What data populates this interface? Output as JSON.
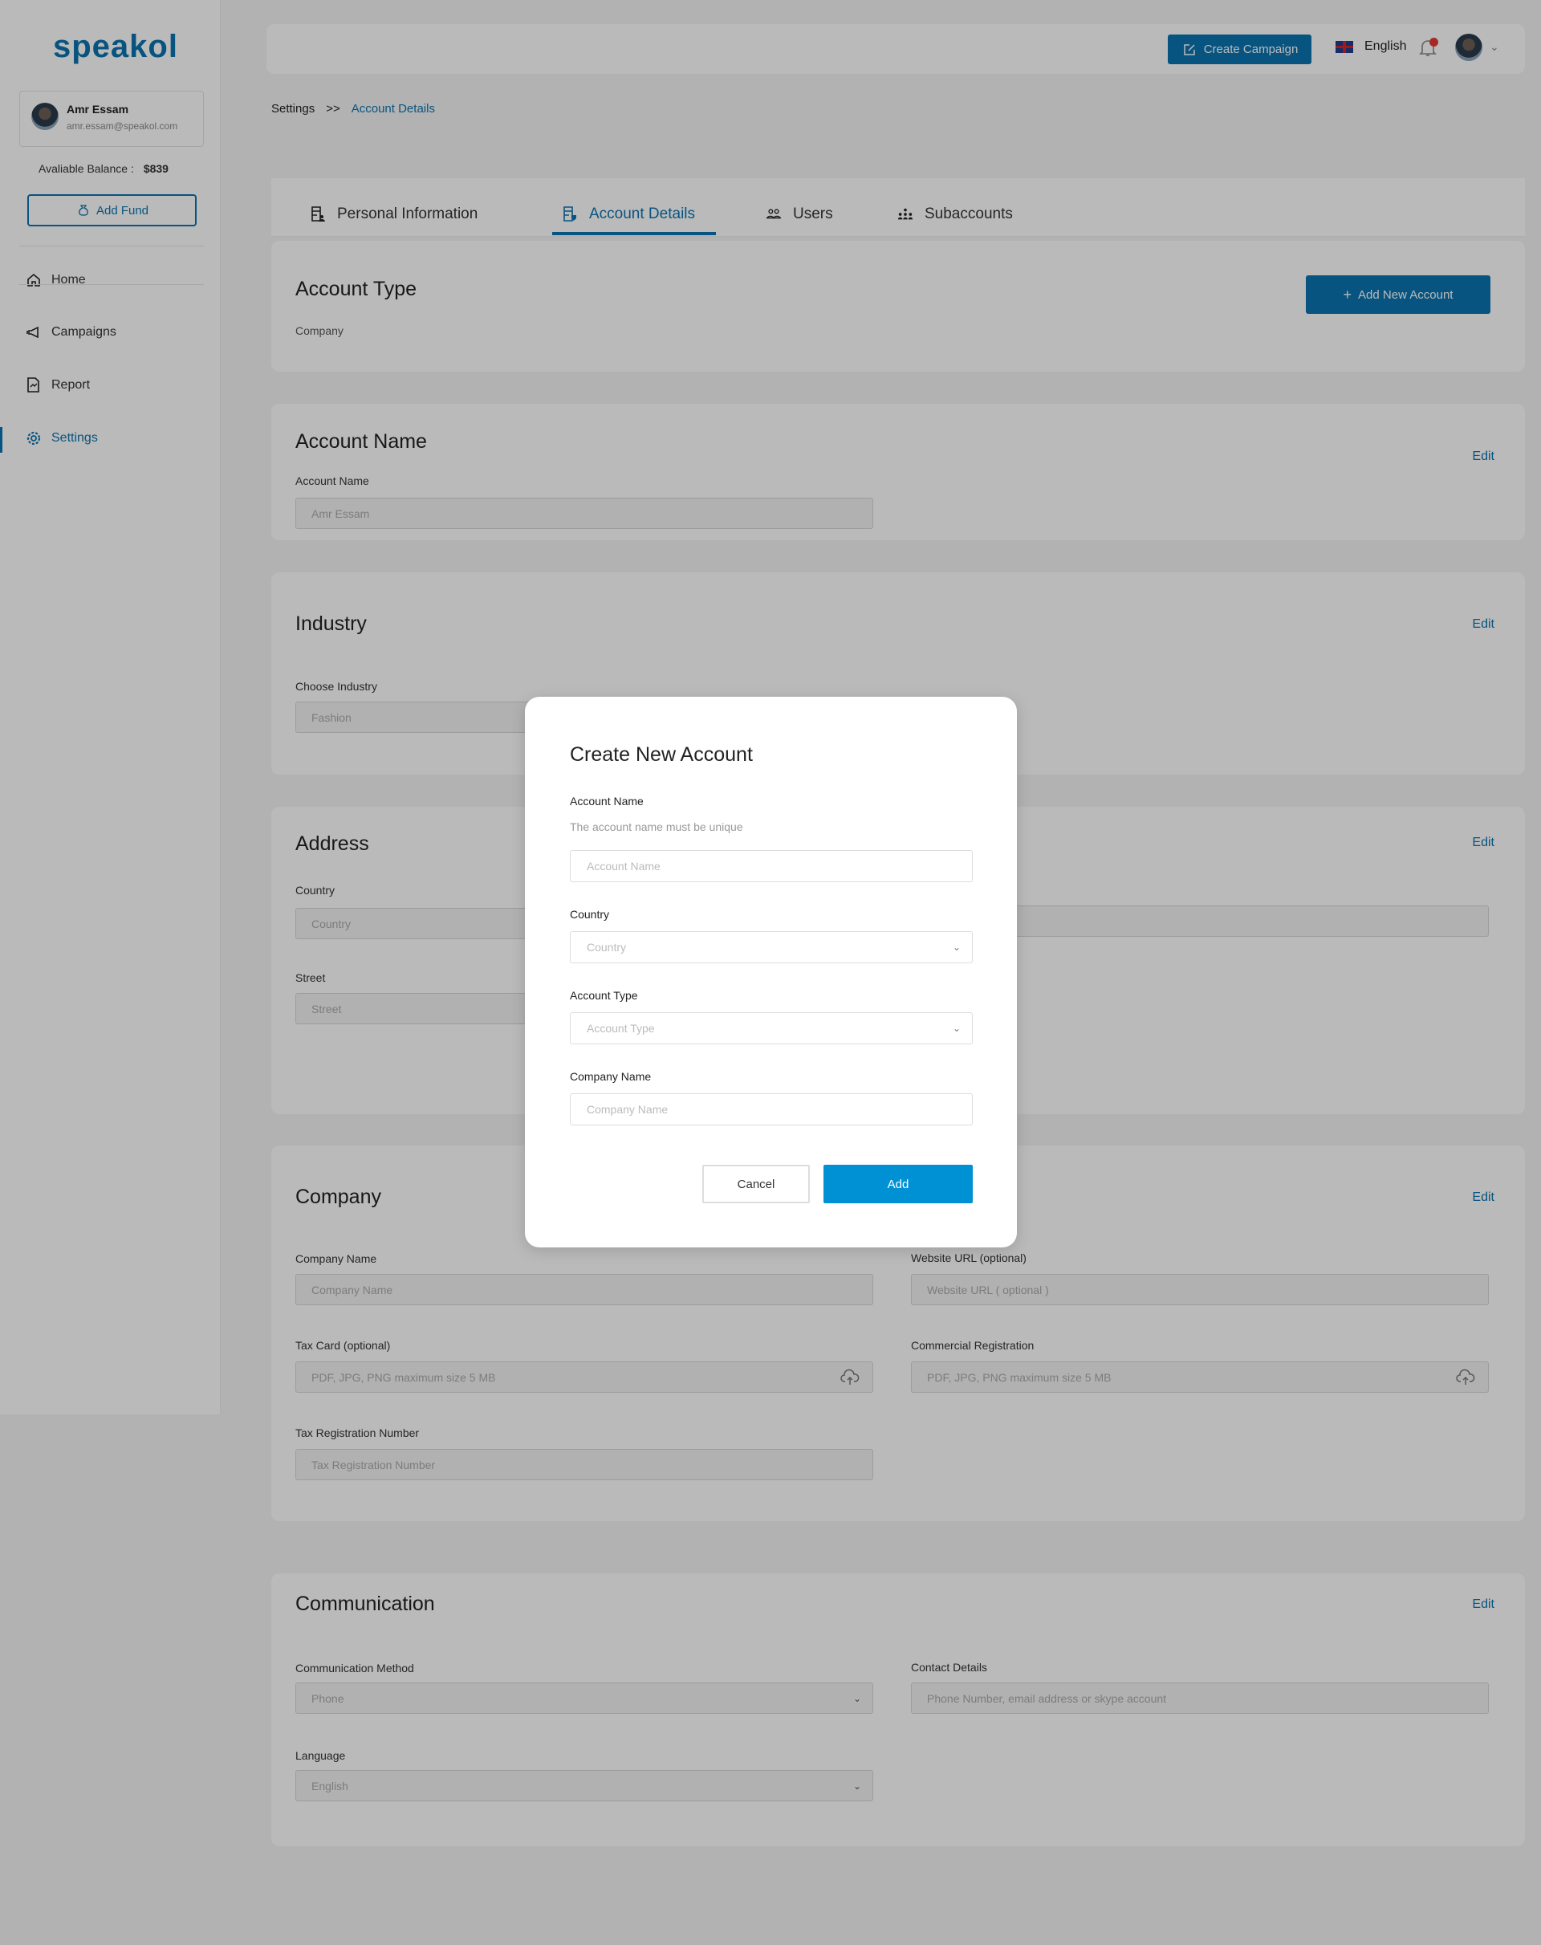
{
  "brand": {
    "logo_text": "speakol",
    "accent": "#0b74b0",
    "modal_accent": "#0091d5"
  },
  "sidebar": {
    "user": {
      "name": "Amr Essam",
      "email": "amr.essam@speakol.com"
    },
    "balance_label": "Avaliable Balance :",
    "balance_value": "$839",
    "add_fund_label": "Add Fund",
    "items": [
      {
        "label": "Home",
        "icon": "home-icon"
      },
      {
        "label": "Campaigns",
        "icon": "megaphone-icon"
      },
      {
        "label": "Report",
        "icon": "report-icon"
      },
      {
        "label": "Settings",
        "icon": "gear-icon",
        "active": true
      }
    ]
  },
  "header": {
    "create_campaign_label": "Create Campaign",
    "language": "English",
    "notification_badge": true
  },
  "breadcrumb": {
    "root": "Settings",
    "separator": ">>",
    "current": "Account Details"
  },
  "tabs": [
    {
      "label": "Personal Information",
      "icon": "personal-info-icon"
    },
    {
      "label": "Account Details",
      "icon": "account-details-icon",
      "active": true
    },
    {
      "label": "Users",
      "icon": "users-icon"
    },
    {
      "label": "Subaccounts",
      "icon": "subaccounts-icon"
    }
  ],
  "sections": {
    "account_type": {
      "title": "Account Type",
      "value": "Company",
      "add_button": "Add New Account"
    },
    "account_name": {
      "title": "Account Name",
      "edit": "Edit",
      "label": "Account Name",
      "value": "Amr Essam"
    },
    "industry": {
      "title": "Industry",
      "edit": "Edit",
      "label": "Choose Industry",
      "value": "Fashion"
    },
    "address": {
      "title": "Address",
      "edit": "Edit",
      "country_label": "Country",
      "country_placeholder": "Country",
      "street_label": "Street",
      "street_placeholder": "Street"
    },
    "company": {
      "title": "Company",
      "edit": "Edit",
      "company_name_label": "Company Name",
      "company_name_placeholder": "Company Name",
      "website_label": "Website URL (optional)",
      "website_placeholder": "Website URL ( optional )",
      "tax_card_label": "Tax Card (optional)",
      "tax_card_placeholder": "PDF, JPG, PNG maximum size 5 MB",
      "commercial_label": "Commercial Registration",
      "commercial_placeholder": "PDF, JPG, PNG maximum size 5 MB",
      "tax_reg_label": "Tax Registration Number",
      "tax_reg_placeholder": "Tax Registration Number"
    },
    "communication": {
      "title": "Communication",
      "edit": "Edit",
      "method_label": "Communication Method",
      "method_value": "Phone",
      "contact_label": "Contact Details",
      "contact_placeholder": "Phone Number, email address or skype account",
      "language_label": "Language",
      "language_value": "English"
    }
  },
  "modal": {
    "title": "Create New Account",
    "account_name_label": "Account Name",
    "account_name_hint": "The account name must be unique",
    "account_name_placeholder": "Account Name",
    "country_label": "Country",
    "country_placeholder": "Country",
    "account_type_label": "Account Type",
    "account_type_placeholder": "Account Type",
    "company_name_label": "Company Name",
    "company_name_placeholder": "Company Name",
    "cancel_label": "Cancel",
    "add_label": "Add"
  }
}
